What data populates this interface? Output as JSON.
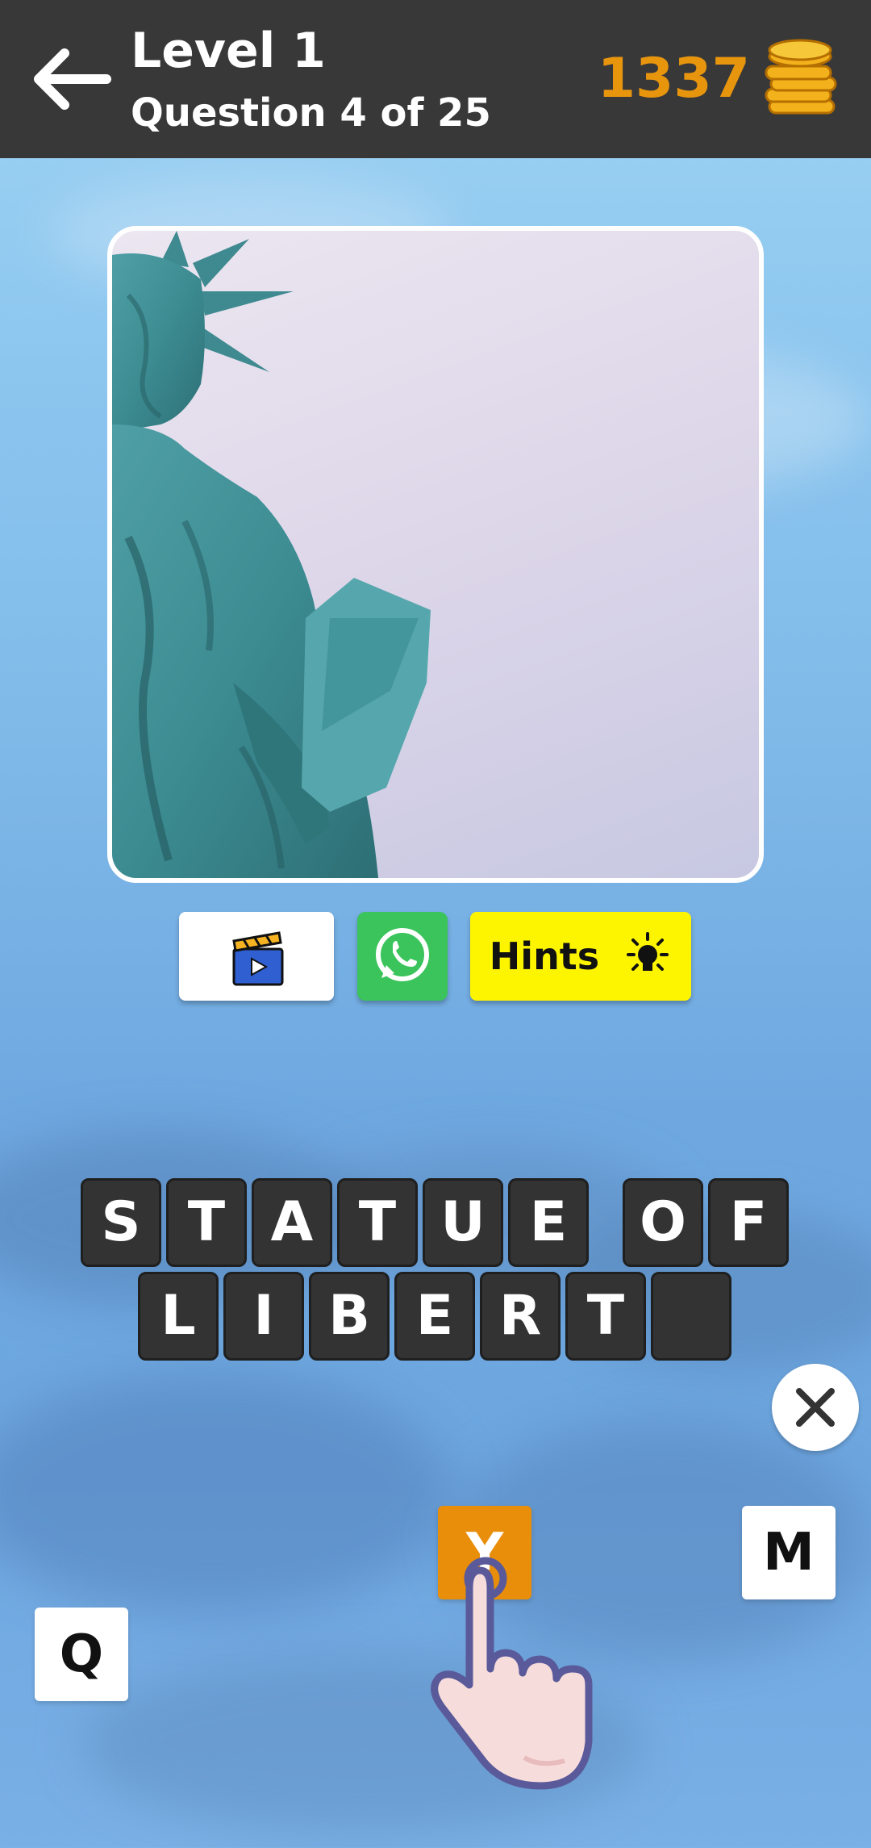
{
  "header": {
    "level_title": "Level 1",
    "question_counter": "Question 4 of 25",
    "coins": "1337"
  },
  "actions": {
    "video_icon": "clapperboard-play-icon",
    "whatsapp_icon": "whatsapp-icon",
    "hints_label": "Hints",
    "hints_icon": "lightbulb-icon"
  },
  "answer": {
    "row1": [
      "S",
      "T",
      "A",
      "T",
      "U",
      "E",
      "",
      "O",
      "F"
    ],
    "row2": [
      "L",
      "I",
      "B",
      "E",
      "R",
      "T",
      ""
    ]
  },
  "keyboard": {
    "keys": [
      "Y",
      "M",
      "Q"
    ],
    "clear_icon": "close-icon"
  },
  "colors": {
    "topbar": "#383838",
    "coins": "#e8950e",
    "hints": "#fdf500",
    "whatsapp": "#3ac45b",
    "tile": "#333333",
    "selected_key": "#e98e0a"
  }
}
